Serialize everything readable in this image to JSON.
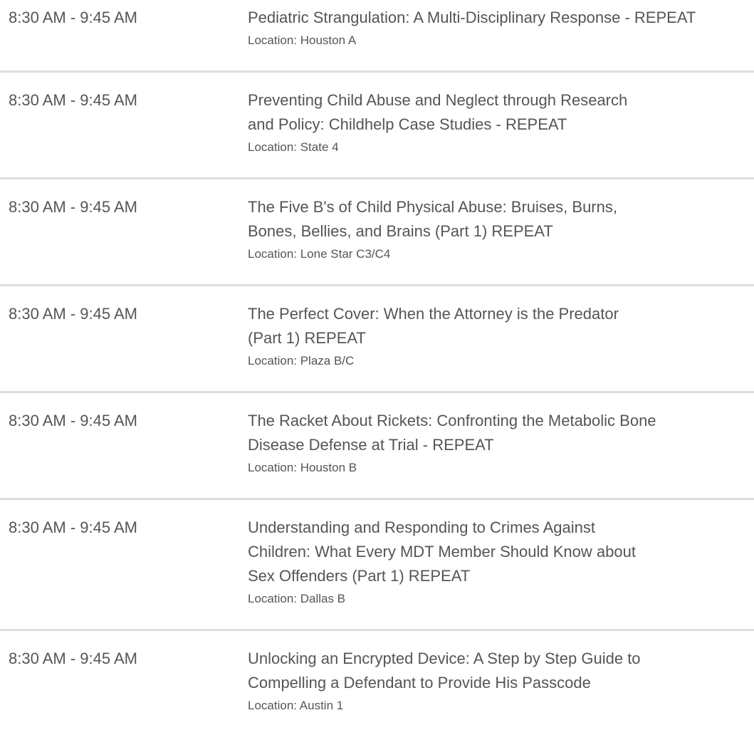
{
  "location_prefix": "Location: ",
  "sessions": [
    {
      "time": "8:30 AM - 9:45 AM",
      "title_lines": [
        "Pediatric Strangulation: A Multi-Disciplinary Response - REPEAT"
      ],
      "location_label": "Location: Houston A"
    },
    {
      "time": "8:30 AM - 9:45 AM",
      "title_lines": [
        "Preventing Child Abuse and Neglect through Research",
        "and Policy: Childhelp Case Studies - REPEAT"
      ],
      "location_label": "Location: State 4"
    },
    {
      "time": "8:30 AM - 9:45 AM",
      "title_lines": [
        "The Five B's of Child Physical Abuse: Bruises, Burns,",
        "Bones, Bellies, and Brains (Part 1) REPEAT"
      ],
      "location_label": "Location: Lone Star C3/C4"
    },
    {
      "time": "8:30 AM - 9:45 AM",
      "title_lines": [
        "The Perfect Cover: When the Attorney is the Predator",
        "(Part 1) REPEAT"
      ],
      "location_label": "Location: Plaza B/C"
    },
    {
      "time": "8:30 AM - 9:45 AM",
      "title_lines": [
        "The Racket About Rickets: Confronting the Metabolic Bone",
        "Disease Defense at Trial - REPEAT"
      ],
      "location_label": "Location: Houston B"
    },
    {
      "time": "8:30 AM - 9:45 AM",
      "title_lines": [
        "Understanding and Responding to Crimes Against",
        "Children: What Every MDT Member Should Know about",
        "Sex Offenders (Part 1) REPEAT"
      ],
      "location_label": "Location: Dallas B"
    },
    {
      "time": "8:30 AM - 9:45 AM",
      "title_lines": [
        "Unlocking an Encrypted Device: A Step by Step Guide to",
        "Compelling a Defendant to Provide His Passcode"
      ],
      "location_label": "Location: Austin 1"
    }
  ]
}
